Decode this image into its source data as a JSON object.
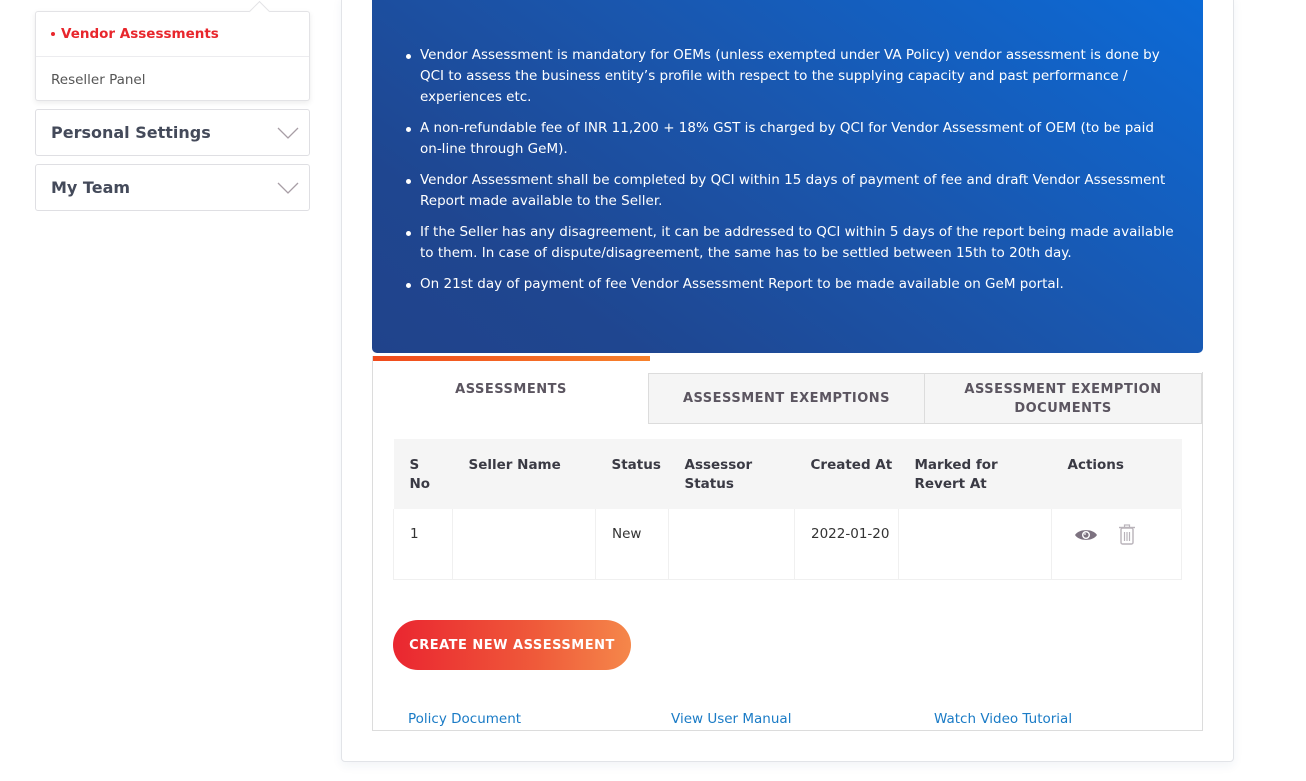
{
  "sidebar": {
    "submenu": {
      "active_item": "Vendor Assessments",
      "items": [
        "Vendor Assessments",
        "Reseller Panel"
      ]
    },
    "accordions": [
      {
        "label": "Personal Settings",
        "icon": "chevron-down-icon"
      },
      {
        "label": "My Team",
        "icon": "chevron-down-icon"
      }
    ]
  },
  "banner": {
    "bullets": [
      "Vendor Assessment is mandatory for OEMs (unless exempted under VA Policy) vendor assessment is done by QCI to assess the business entity’s profile with respect to the supplying capacity and past performance / experiences etc.",
      "A non-refundable fee of INR 11,200 + 18% GST is charged by QCI for Vendor Assessment of OEM (to be paid on-line through GeM).",
      "Vendor Assessment shall be completed by QCI within 15 days of payment of fee and draft Vendor Assessment Report made available to the Seller.",
      "If the Seller has any disagreement, it can be addressed to QCI within 5 days of the report being made available to them. In case of dispute/disagreement, the same has to be settled between 15th to 20th day.",
      "On 21st day of payment of fee Vendor Assessment Report to be made available on GeM portal."
    ]
  },
  "tabs": [
    {
      "label": "ASSESSMENTS",
      "active": true
    },
    {
      "label": "ASSESSMENT EXEMPTIONS",
      "active": false
    },
    {
      "label": "ASSESSMENT EXEMPTION DOCUMENTS",
      "active": false
    }
  ],
  "table": {
    "columns": [
      "S No",
      "Seller Name",
      "Status",
      "Assessor Status",
      "Created At",
      "Marked for Revert At",
      "Actions"
    ],
    "rows": [
      {
        "s_no": "1",
        "seller_name": "",
        "status": "New",
        "assessor_status": "",
        "created_at": "2022-01-20",
        "marked_for_revert_at": "",
        "actions": [
          "view-icon",
          "delete-icon"
        ]
      }
    ]
  },
  "buttons": {
    "create_new_assessment": "CREATE NEW ASSESSMENT"
  },
  "links": {
    "policy_document": "Policy Document",
    "view_user_manual": "View User Manual",
    "watch_video_tutorial": "Watch Video Tutorial"
  },
  "colors": {
    "accent_red": "#e8262c",
    "banner_blue": "#1f4690",
    "link_blue": "#1a7bc6",
    "tab_active_bar": "#f04a1c"
  }
}
